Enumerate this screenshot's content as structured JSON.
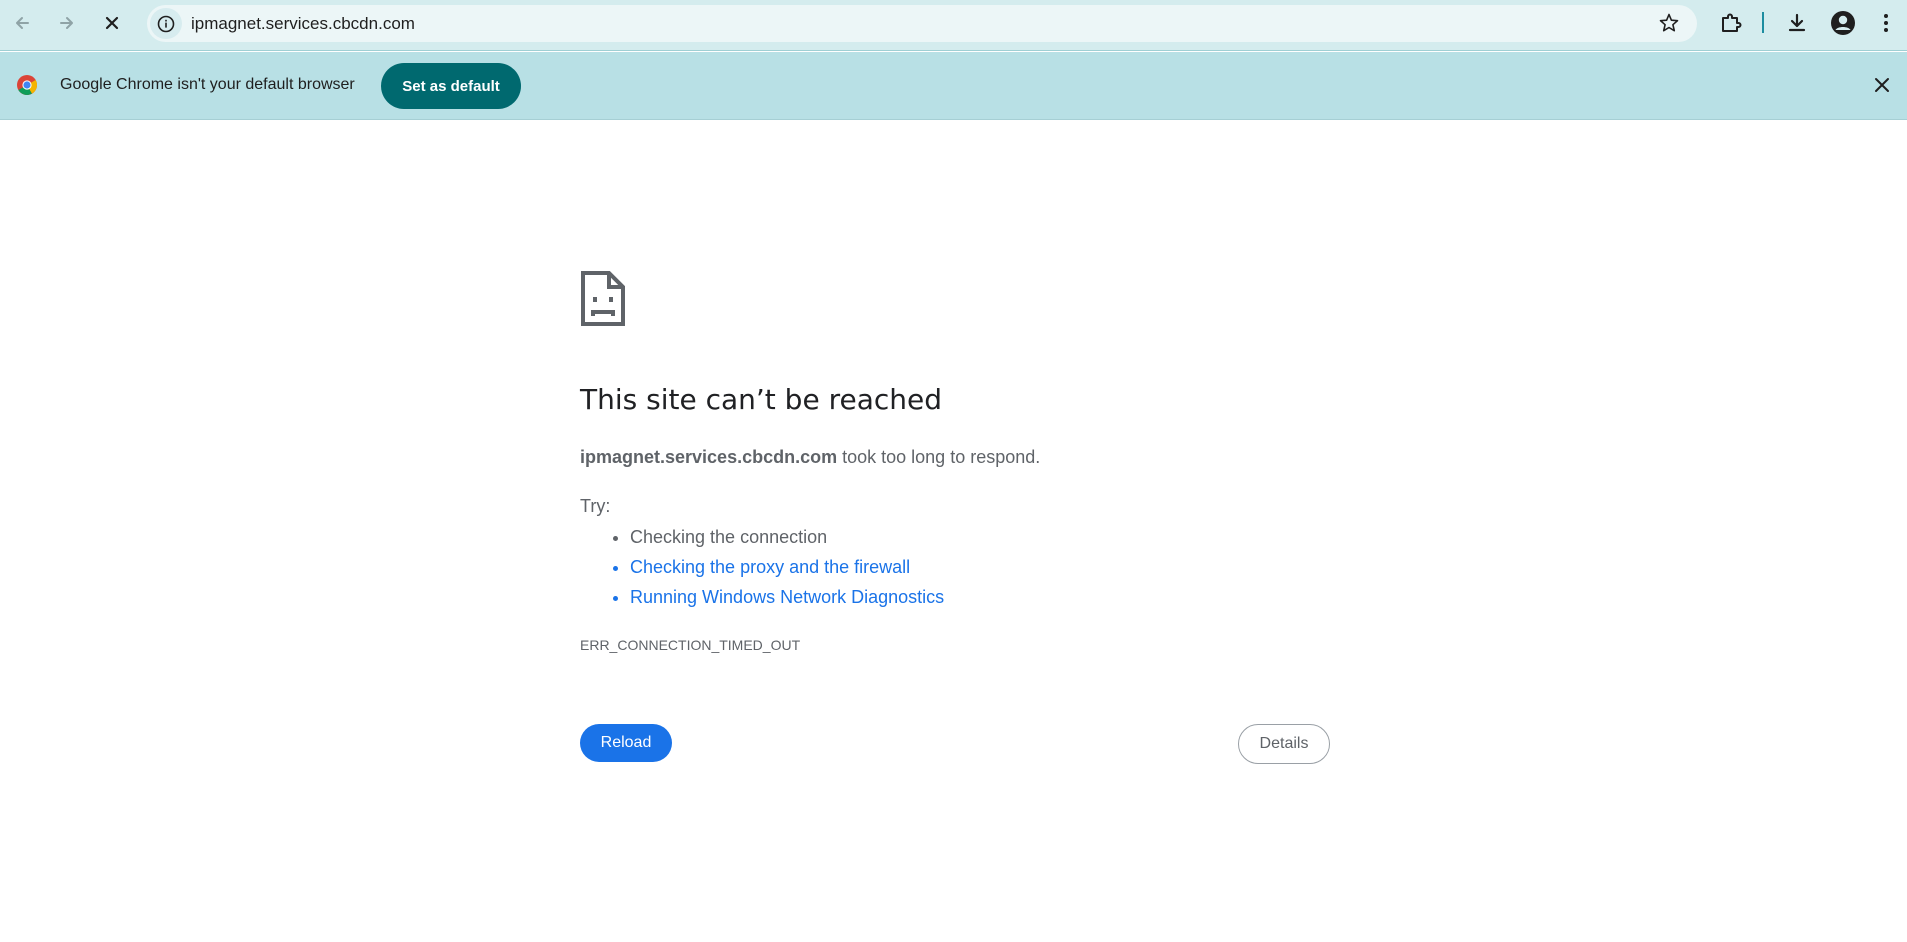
{
  "browser": {
    "url": "ipmagnet.services.cbcdn.com",
    "icons": {
      "back": "arrow-left-icon",
      "forward": "arrow-right-icon",
      "stop": "close-icon",
      "site_info": "info-icon",
      "bookmark": "star-icon",
      "extensions": "puzzle-icon",
      "downloads": "download-icon",
      "profile": "person-icon",
      "menu": "kebab-menu-icon"
    },
    "colors": {
      "toolbar_bg": "#d4ecee",
      "infobar_bg": "#b8e0e5",
      "accent": "#00696f"
    }
  },
  "infobar": {
    "message": "Google Chrome isn't your default browser",
    "button_label": "Set as default"
  },
  "error_page": {
    "heading": "This site can’t be reached",
    "host": "ipmagnet.services.cbcdn.com",
    "summary_suffix": " took too long to respond.",
    "try_label": "Try:",
    "suggestions": [
      {
        "text": "Checking the connection",
        "link": false
      },
      {
        "text": "Checking the proxy and the firewall",
        "link": true
      },
      {
        "text": "Running Windows Network Diagnostics",
        "link": true
      }
    ],
    "error_code": "ERR_CONNECTION_TIMED_OUT",
    "reload_label": "Reload",
    "details_label": "Details",
    "colors": {
      "link": "#1a73e8",
      "primary_button": "#1a73e8",
      "text": "#5f6368"
    }
  }
}
